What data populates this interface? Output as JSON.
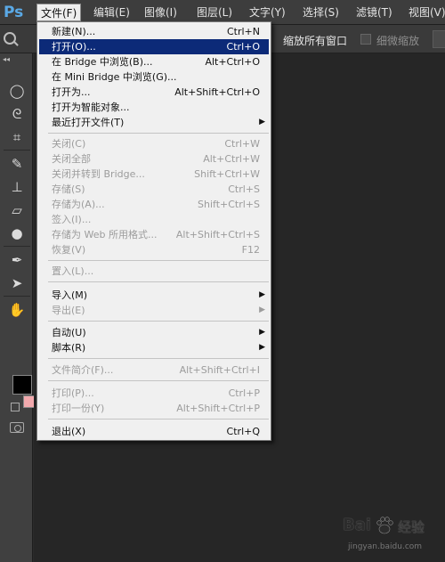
{
  "app": {
    "logo": "Ps"
  },
  "menubar": {
    "items": [
      {
        "label": "文件(F)",
        "active": true
      },
      {
        "label": "编辑(E)"
      },
      {
        "label": "图像(I)"
      },
      {
        "label": "图层(L)"
      },
      {
        "label": "文字(Y)"
      },
      {
        "label": "选择(S)"
      },
      {
        "label": "滤镜(T)"
      },
      {
        "label": "视图(V)"
      }
    ]
  },
  "options": {
    "fit_all_windows_label": "缩放所有窗口",
    "scrubby_zoom_label": "细微缩放"
  },
  "toolbar": {
    "collapse_glyph": "◂◂",
    "fg_color": "#000000",
    "bg_color": "#f2a9ad"
  },
  "file_menu": {
    "items": [
      {
        "label": "新建(N)...",
        "shortcut": "Ctrl+N"
      },
      {
        "label": "打开(O)...",
        "shortcut": "Ctrl+O",
        "highlighted": true
      },
      {
        "label": "在 Bridge 中浏览(B)...",
        "shortcut": "Alt+Ctrl+O"
      },
      {
        "label": "在 Mini Bridge 中浏览(G)...",
        "shortcut": ""
      },
      {
        "label": "打开为...",
        "shortcut": "Alt+Shift+Ctrl+O"
      },
      {
        "label": "打开为智能对象...",
        "shortcut": ""
      },
      {
        "label": "最近打开文件(T)",
        "shortcut": "",
        "submenu": true
      },
      {
        "label": "关闭(C)",
        "shortcut": "Ctrl+W",
        "disabled": true
      },
      {
        "label": "关闭全部",
        "shortcut": "Alt+Ctrl+W",
        "disabled": true
      },
      {
        "label": "关闭并转到 Bridge...",
        "shortcut": "Shift+Ctrl+W",
        "disabled": true
      },
      {
        "label": "存储(S)",
        "shortcut": "Ctrl+S",
        "disabled": true
      },
      {
        "label": "存储为(A)...",
        "shortcut": "Shift+Ctrl+S",
        "disabled": true
      },
      {
        "label": "签入(I)...",
        "shortcut": "",
        "disabled": true
      },
      {
        "label": "存储为 Web 所用格式...",
        "shortcut": "Alt+Shift+Ctrl+S",
        "disabled": true
      },
      {
        "label": "恢复(V)",
        "shortcut": "F12",
        "disabled": true
      },
      {
        "label": "置入(L)...",
        "shortcut": "",
        "disabled": true
      },
      {
        "label": "导入(M)",
        "shortcut": "",
        "submenu": true
      },
      {
        "label": "导出(E)",
        "shortcut": "",
        "submenu": true,
        "disabled": true
      },
      {
        "label": "自动(U)",
        "shortcut": "",
        "submenu": true
      },
      {
        "label": "脚本(R)",
        "shortcut": "",
        "submenu": true
      },
      {
        "label": "文件简介(F)...",
        "shortcut": "Alt+Shift+Ctrl+I",
        "disabled": true
      },
      {
        "label": "打印(P)...",
        "shortcut": "Ctrl+P",
        "disabled": true
      },
      {
        "label": "打印一份(Y)",
        "shortcut": "Alt+Shift+Ctrl+P",
        "disabled": true
      },
      {
        "label": "退出(X)",
        "shortcut": "Ctrl+Q"
      }
    ],
    "submenu_arrow": "▶"
  },
  "watermark": {
    "brand_text": "Bai",
    "product_text": "经验",
    "url": "jingyan.baidu.com"
  },
  "colors": {
    "highlight": "#0c2a78",
    "logo_blue": "#5aa9e6",
    "menu_bg": "#f0f0f0"
  }
}
